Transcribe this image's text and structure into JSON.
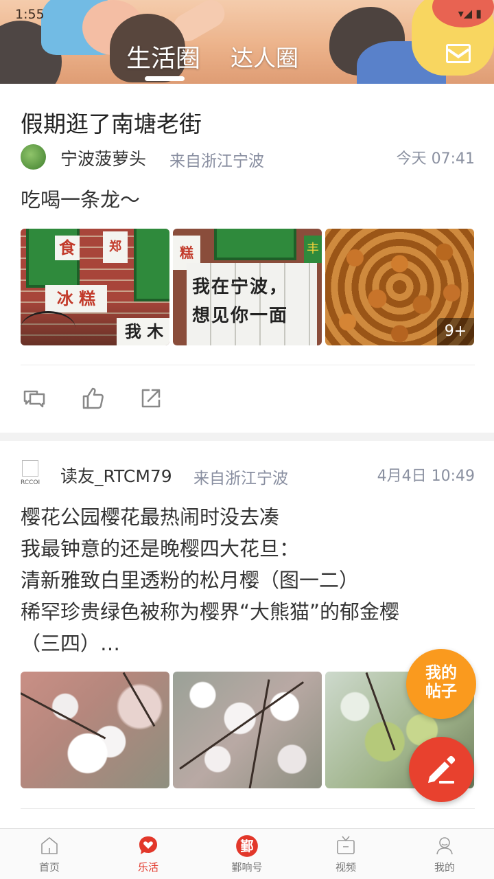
{
  "status_bar": {
    "time": "1:55"
  },
  "header": {
    "tabs": [
      {
        "label": "生活圈",
        "active": true
      },
      {
        "label": "达人圈",
        "active": false
      }
    ],
    "mail_icon": "envelope-icon"
  },
  "posts": [
    {
      "title": "假期逛了南塘老街",
      "author": "宁波菠萝头",
      "location": "来自浙江宁波",
      "time": "今天 07:41",
      "body": "吃喝一条龙～",
      "photos": [
        {
          "sign_food": "食",
          "sign_ice": "冰 糕",
          "sign_red": "郑",
          "sign_bottom": "我 木"
        },
        {
          "text_line1": "我在宁波，",
          "text_line2": "想见你一面",
          "sign_top": "糕",
          "sign_right": "丰"
        },
        {
          "more": "9+"
        }
      ],
      "actions": [
        "comment-icon",
        "like-icon",
        "share-icon"
      ]
    },
    {
      "author": "读友_RTCM79",
      "avatar_text": "RCCOI",
      "location": "来自浙江宁波",
      "time": "4月4日 10:49",
      "body_lines": [
        "樱花公园樱花最热闹时没去凑",
        "我最钟意的还是晚樱四大花旦：",
        "清新雅致白里透粉的松月樱（图一二）",
        "稀罕珍贵绿色被称为樱界“大熊猫”的郁金樱",
        "（三四）…"
      ]
    }
  ],
  "floating": {
    "my_posts_line1": "我的",
    "my_posts_line2": "帖子",
    "edit_icon": "pencil-icon"
  },
  "bottom_nav": [
    {
      "label": "首页",
      "icon": "home-icon"
    },
    {
      "label": "乐活",
      "icon": "heart-chat-icon",
      "active": true
    },
    {
      "label": "鄞响号",
      "icon": "yin-logo-icon",
      "logo_char": "鄞"
    },
    {
      "label": "视频",
      "icon": "tv-icon"
    },
    {
      "label": "我的",
      "icon": "person-icon"
    }
  ],
  "colors": {
    "accent_red": "#e8412e",
    "accent_orange": "#fa9a1e",
    "meta_gray": "#888ea0"
  }
}
